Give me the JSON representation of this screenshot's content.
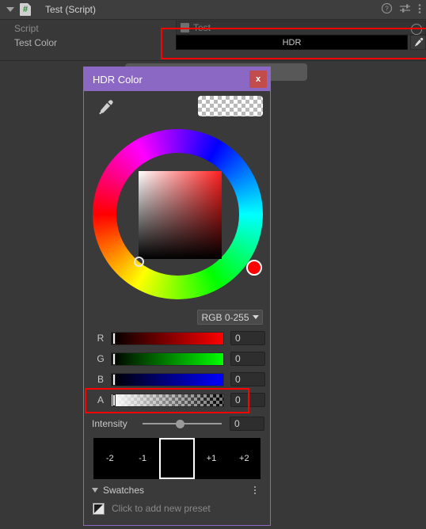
{
  "inspector": {
    "component_title": "Test (Script)",
    "script_badge_glyph": "#",
    "foldout_expanded": true,
    "header_icons": [
      "help-icon",
      "preset-icon",
      "more-menu-icon"
    ],
    "rows": [
      {
        "label": "Script",
        "value": "Test",
        "type": "object-field"
      },
      {
        "label": "Test Color",
        "value": "HDR",
        "type": "color-field"
      }
    ]
  },
  "dialog": {
    "title": "HDR Color",
    "close_label": "x",
    "eyedropper_icon": "eyedropper-icon",
    "preview_swatch": "transparent-checker",
    "color_wheel": {
      "hue_handle_color": "#ff0000",
      "sv_square_top_right": "#ff1f1f"
    },
    "mode_dropdown": {
      "value": "RGB 0-255",
      "caret": "chevron-down-icon"
    },
    "channels": [
      {
        "name": "R",
        "value": "0",
        "track": "red"
      },
      {
        "name": "G",
        "value": "0",
        "track": "green"
      },
      {
        "name": "B",
        "value": "0",
        "track": "blue"
      },
      {
        "name": "A",
        "value": "0",
        "track": "alpha-checker"
      }
    ],
    "intensity": {
      "label": "Intensity",
      "value": "0"
    },
    "exposure_presets": [
      {
        "label": "-2",
        "selected": false
      },
      {
        "label": "-1",
        "selected": false
      },
      {
        "label": "",
        "selected": true
      },
      {
        "label": "+1",
        "selected": false
      },
      {
        "label": "+2",
        "selected": false
      }
    ],
    "swatches": {
      "label": "Swatches",
      "expanded": true,
      "menu_icon": "kebab-menu-icon",
      "add_preset_text": "Click to add new preset",
      "add_preset_icon": "color-swatch-icon"
    }
  },
  "annotations": {
    "accent_color": "#ff0000",
    "boxes": [
      "color-field-highlight",
      "alpha-row-highlight"
    ]
  },
  "colors": {
    "window_bg": "#383838",
    "dialog_bg": "#3a3a3a",
    "title_bar": "#8b68c4",
    "close_button": "#c24b4b",
    "highlight": "#ff0000"
  }
}
